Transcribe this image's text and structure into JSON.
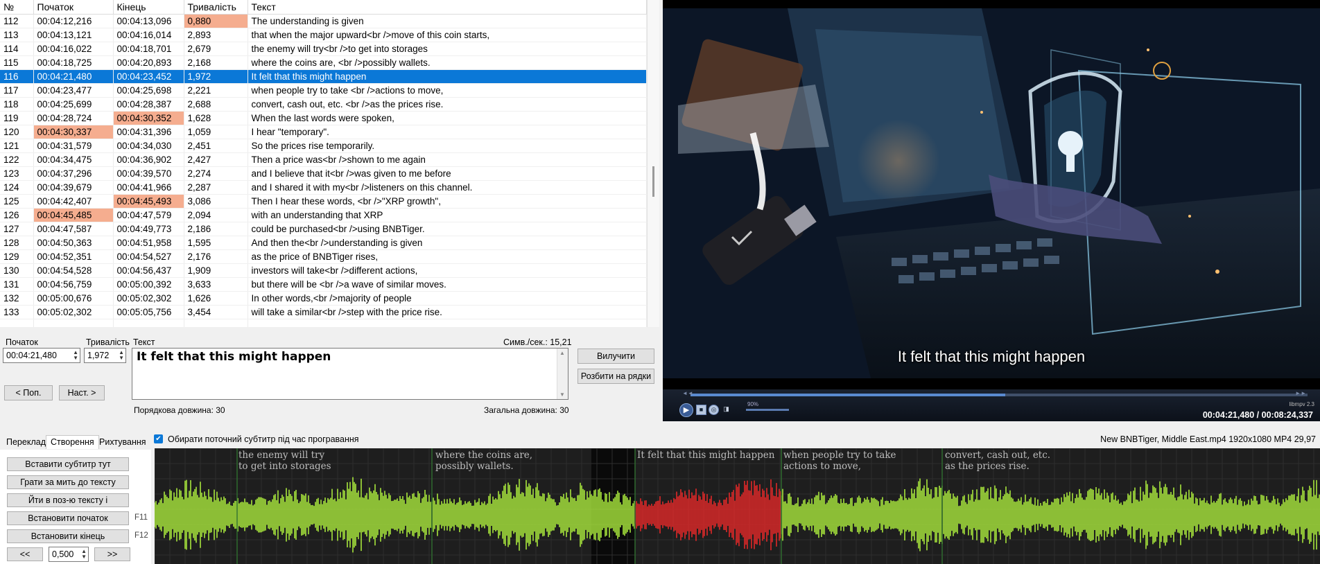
{
  "grid": {
    "headers": [
      "№",
      "Початок",
      "Кінець",
      "Тривалість",
      "Текст"
    ],
    "rows": [
      {
        "n": "112",
        "start": "00:04:12,216",
        "end": "00:04:13,096",
        "dur": "0,880",
        "text": "The understanding is given",
        "hl": [
          "dur"
        ]
      },
      {
        "n": "113",
        "start": "00:04:13,121",
        "end": "00:04:16,014",
        "dur": "2,893",
        "text": "that when the major upward<br />move of this coin starts,",
        "hl": []
      },
      {
        "n": "114",
        "start": "00:04:16,022",
        "end": "00:04:18,701",
        "dur": "2,679",
        "text": "the enemy will try<br />to get into storages",
        "hl": []
      },
      {
        "n": "115",
        "start": "00:04:18,725",
        "end": "00:04:20,893",
        "dur": "2,168",
        "text": "where the coins are, <br />possibly wallets.",
        "hl": []
      },
      {
        "n": "116",
        "start": "00:04:21,480",
        "end": "00:04:23,452",
        "dur": "1,972",
        "text": "It felt that this might happen",
        "hl": [],
        "selected": true
      },
      {
        "n": "117",
        "start": "00:04:23,477",
        "end": "00:04:25,698",
        "dur": "2,221",
        "text": "when people try to take <br />actions to move,",
        "hl": []
      },
      {
        "n": "118",
        "start": "00:04:25,699",
        "end": "00:04:28,387",
        "dur": "2,688",
        "text": "convert, cash out, etc. <br />as the prices rise.",
        "hl": []
      },
      {
        "n": "119",
        "start": "00:04:28,724",
        "end": "00:04:30,352",
        "dur": "1,628",
        "text": "When the last words were spoken,",
        "hl": [
          "end"
        ]
      },
      {
        "n": "120",
        "start": "00:04:30,337",
        "end": "00:04:31,396",
        "dur": "1,059",
        "text": "I hear \"temporary\".",
        "hl": [
          "start"
        ]
      },
      {
        "n": "121",
        "start": "00:04:31,579",
        "end": "00:04:34,030",
        "dur": "2,451",
        "text": "So the prices rise temporarily.",
        "hl": []
      },
      {
        "n": "122",
        "start": "00:04:34,475",
        "end": "00:04:36,902",
        "dur": "2,427",
        "text": "Then a price was<br />shown to me again",
        "hl": []
      },
      {
        "n": "123",
        "start": "00:04:37,296",
        "end": "00:04:39,570",
        "dur": "2,274",
        "text": "and I believe that it<br />was given to me before",
        "hl": []
      },
      {
        "n": "124",
        "start": "00:04:39,679",
        "end": "00:04:41,966",
        "dur": "2,287",
        "text": "and I shared it with my<br />listeners on this channel.",
        "hl": []
      },
      {
        "n": "125",
        "start": "00:04:42,407",
        "end": "00:04:45,493",
        "dur": "3,086",
        "text": "Then I hear these words, <br />\"XRP growth\",",
        "hl": [
          "end"
        ]
      },
      {
        "n": "126",
        "start": "00:04:45,485",
        "end": "00:04:47,579",
        "dur": "2,094",
        "text": "with an understanding that XRP",
        "hl": [
          "start"
        ]
      },
      {
        "n": "127",
        "start": "00:04:47,587",
        "end": "00:04:49,773",
        "dur": "2,186",
        "text": "could be purchased<br />using BNBTiger.",
        "hl": []
      },
      {
        "n": "128",
        "start": "00:04:50,363",
        "end": "00:04:51,958",
        "dur": "1,595",
        "text": "And then the<br />understanding is given",
        "hl": []
      },
      {
        "n": "129",
        "start": "00:04:52,351",
        "end": "00:04:54,527",
        "dur": "2,176",
        "text": "as the price of BNBTiger rises,",
        "hl": []
      },
      {
        "n": "130",
        "start": "00:04:54,528",
        "end": "00:04:56,437",
        "dur": "1,909",
        "text": "investors will take<br />different actions,",
        "hl": []
      },
      {
        "n": "131",
        "start": "00:04:56,759",
        "end": "00:05:00,392",
        "dur": "3,633",
        "text": "but there will be <br />a wave of similar moves.",
        "hl": []
      },
      {
        "n": "132",
        "start": "00:05:00,676",
        "end": "00:05:02,302",
        "dur": "1,626",
        "text": "In other words,<br />majority of people",
        "hl": []
      },
      {
        "n": "133",
        "start": "00:05:02,302",
        "end": "00:05:05,756",
        "dur": "3,454",
        "text": "will take a similar<br />step with the price rise.",
        "hl": []
      }
    ]
  },
  "editor": {
    "start_label": "Початок",
    "dur_label": "Тривалість",
    "text_label": "Текст",
    "cps": "Симв./сек.: 15,21",
    "start_value": "00:04:21,480",
    "dur_value": "1,972",
    "text_value": "It felt that this might happen",
    "prev_button": "< Поп.",
    "next_button": "Наст. >",
    "remove_button": "Вилучити",
    "split_button": "Розбити на рядки",
    "line_length": "Порядкова довжина: 30",
    "total_length": "Загальна довжина: 30"
  },
  "video": {
    "subtitle": "It felt that this might happen",
    "time": "00:04:21,480 / 00:08:24,337",
    "volume": "90%",
    "player_name": "libmpv 2.3",
    "progress": 0.51
  },
  "lower": {
    "tabs": [
      "Переклад",
      "Створення",
      "Рихтування"
    ],
    "checkbox_label": "Обирати поточний субтитр під час програвання",
    "file_info": "New BNBTiger, Middle East.mp4 1920x1080 MP4 29,97",
    "buttons": {
      "insert": "Вставити субтитр тут",
      "play_for_text": "Грати за мить до тексту",
      "go_to_text": "Йти в поз-ю тексту і",
      "set_start": "Встановити початок",
      "set_end": "Встановити кінець"
    },
    "f11": "F11",
    "f12": "F12",
    "back": "<<",
    "forward": ">>",
    "step_value": "0,500"
  },
  "waveform": {
    "segments": [
      {
        "text": "the enemy will try\nto get into storages"
      },
      {
        "text": "where the coins are,\npossibly wallets."
      },
      {
        "text": "It felt that this might happen"
      },
      {
        "text": "when people try to take\nactions to move,"
      },
      {
        "text": "convert, cash out, etc.\nas the prices rise."
      }
    ],
    "colors": {
      "wave": "#a8e63c",
      "selected_wave": "#e02828",
      "background": "#1e1e1e",
      "selected_background": "#0a0a0a"
    }
  }
}
